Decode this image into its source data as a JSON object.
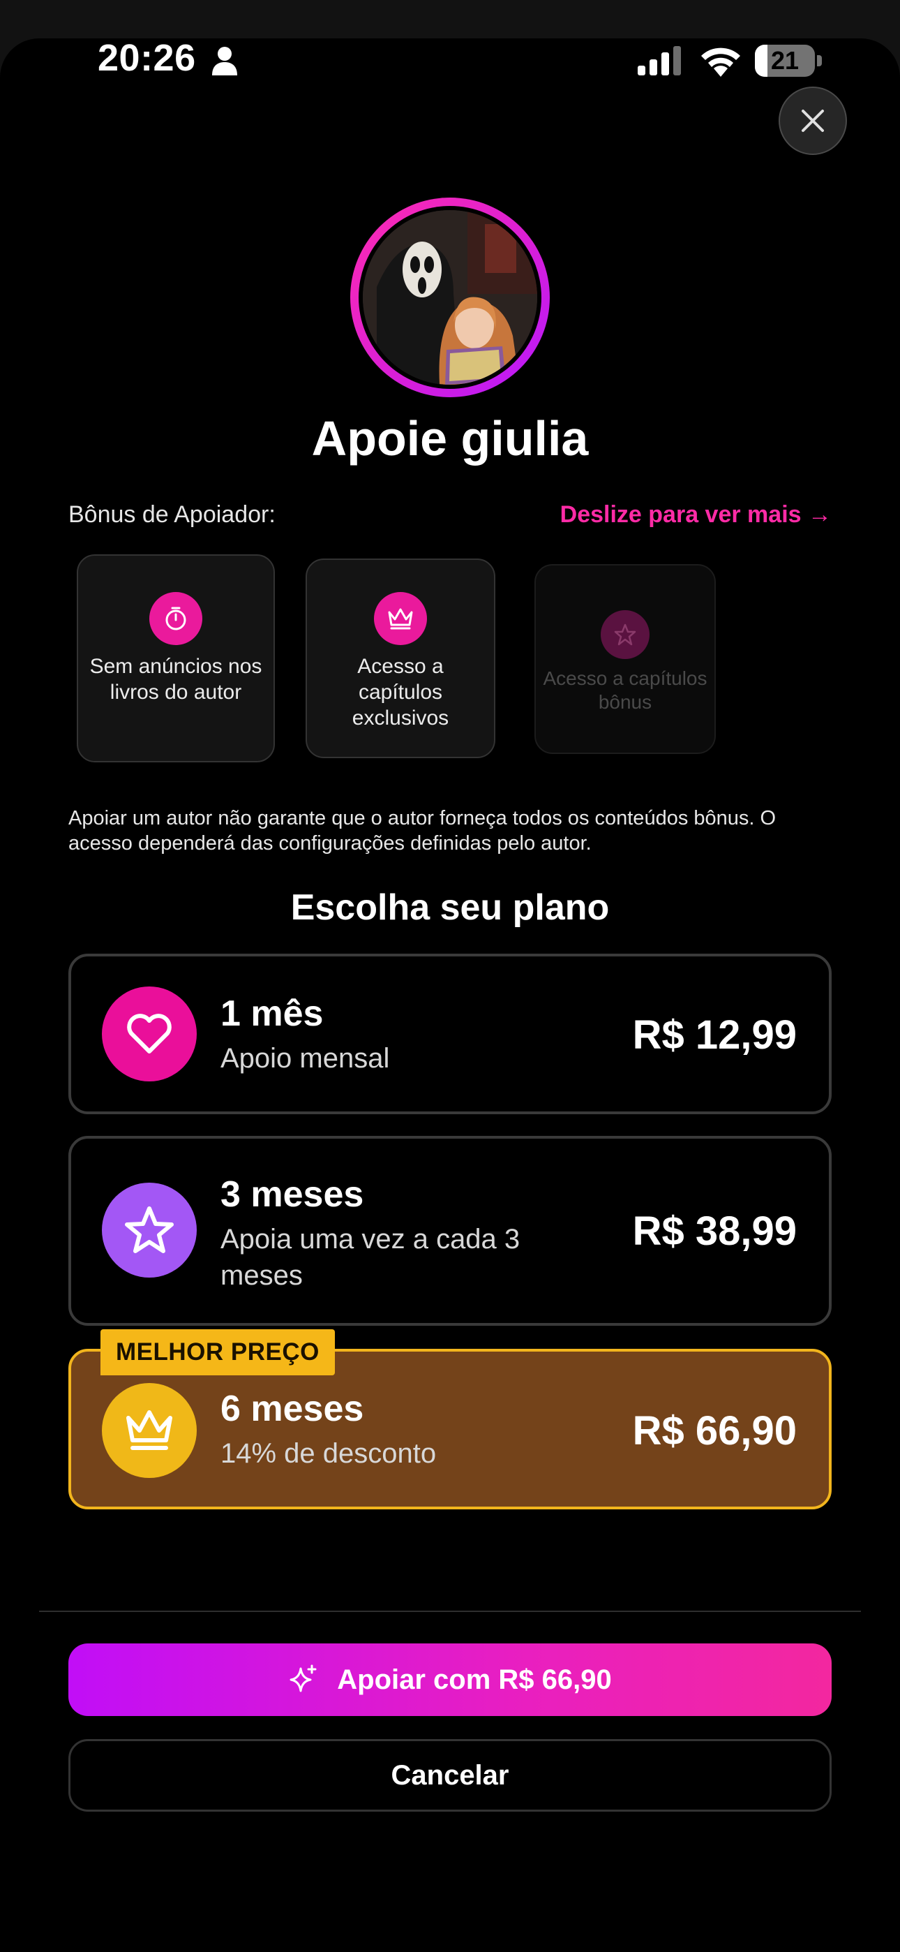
{
  "status_bar": {
    "time": "20:26",
    "battery": "21",
    "battery_level": 0.21
  },
  "header": {
    "title": "Apoie giulia",
    "close_icon": "close-icon"
  },
  "bonus": {
    "label": "Bônus de Apoiador:",
    "swipe_hint": "Deslize para ver mais →",
    "items": [
      {
        "icon": "stopwatch-icon",
        "text": "Sem anúncios nos livros do autor"
      },
      {
        "icon": "crown-icon",
        "text": "Acesso a capítulos exclusivos"
      },
      {
        "icon": "star-icon",
        "text": "Acesso a capítulos bônus"
      }
    ]
  },
  "disclaimer": "Apoiar um autor não garante que o autor forneça todos os conteúdos bônus. O acesso dependerá das configurações definidas pelo autor.",
  "plans": {
    "heading": "Escolha seu plano",
    "items": [
      {
        "icon": "heart-icon",
        "color": "#ea0f9a",
        "title": "1 mês",
        "subtitle": "Apoio mensal",
        "price": "R$ 12,99"
      },
      {
        "icon": "star-icon",
        "color": "#a357f5",
        "title": "3 meses",
        "subtitle": "Apoia uma vez a cada 3 meses",
        "price": "R$ 38,99"
      },
      {
        "icon": "crown-icon",
        "color": "#f0b818",
        "title": "6 meses",
        "subtitle": "14% de desconto",
        "price": "R$ 66,90",
        "badge": "MELHOR PREÇO",
        "selected": true
      }
    ]
  },
  "actions": {
    "support_label": "Apoiar com R$ 66,90",
    "cancel_label": "Cancelar"
  },
  "colors": {
    "accent": "#ff2ba6",
    "best_bg": "#74431a",
    "best_border": "#f2b51d"
  }
}
